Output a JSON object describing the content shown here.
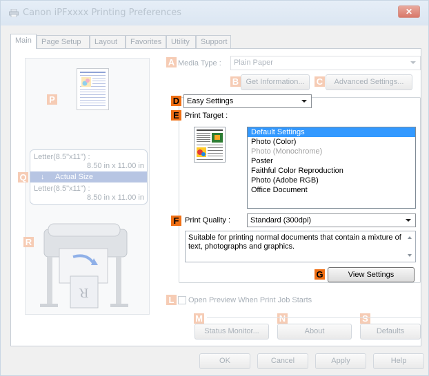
{
  "window": {
    "title": "Canon iPFxxxx Printing Preferences",
    "close_glyph": "✕"
  },
  "tabs": [
    "Main",
    "Page Setup",
    "Layout",
    "Favorites",
    "Utility",
    "Support"
  ],
  "callouts": {
    "A": "A",
    "B": "B",
    "C": "C",
    "D": "D",
    "E": "E",
    "F": "F",
    "G": "G",
    "L": "L",
    "M": "M",
    "N": "N",
    "S": "S",
    "P": "P",
    "Q": "Q",
    "R": "R"
  },
  "media": {
    "label": "Media Type :",
    "value": "Plain Paper",
    "get_info": "Get Information...",
    "advanced": "Advanced Settings..."
  },
  "mode": {
    "value": "Easy Settings"
  },
  "print_target": {
    "label": "Print Target :",
    "items": [
      {
        "label": "Default Settings",
        "state": "selected"
      },
      {
        "label": "Photo (Color)",
        "state": "normal"
      },
      {
        "label": "Photo (Monochrome)",
        "state": "disabled"
      },
      {
        "label": "Poster",
        "state": "normal"
      },
      {
        "label": "Faithful Color Reproduction",
        "state": "normal"
      },
      {
        "label": "Photo (Adobe RGB)",
        "state": "normal"
      },
      {
        "label": "Office Document",
        "state": "normal"
      }
    ]
  },
  "print_quality": {
    "label": "Print Quality :",
    "value": "Standard (300dpi)",
    "description": "Suitable for printing normal documents that contain a mixture of text, photographs and graphics."
  },
  "view_settings": "View Settings",
  "preview": {
    "paper_size_1": "Letter(8.5\"x11\") :",
    "dims_1": "8.50 in x 11.00 in",
    "actual_size": "Actual Size",
    "paper_size_2": "Letter(8.5\"x11\") :",
    "dims_2": "8.50 in x 11.00 in"
  },
  "open_preview": "Open Preview When Print Job Starts",
  "status_monitor": "Status Monitor...",
  "about": "About",
  "defaults": "Defaults",
  "footer": {
    "ok": "OK",
    "cancel": "Cancel",
    "apply": "Apply",
    "help": "Help"
  },
  "colors": {
    "accent_callout": "#ef6f14",
    "dim_callout": "#f6ccb5",
    "selection": "#3399ff",
    "actual_size_bar": "#b7c5e3"
  }
}
